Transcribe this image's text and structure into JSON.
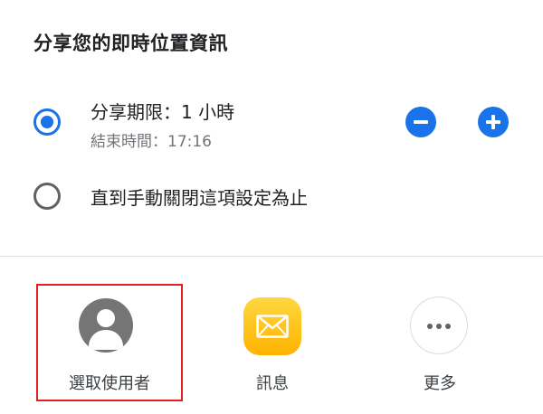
{
  "dialog": {
    "title": "分享您的即時位置資訊"
  },
  "options": [
    {
      "label": "分享期限：1 小時",
      "sublabel": "結束時間：17:16",
      "selected": true
    },
    {
      "label": "直到手動關閉這項設定為止",
      "selected": false
    }
  ],
  "duration_controls": {
    "decrease_icon": "minus-icon",
    "increase_icon": "plus-icon",
    "accent_color": "#1a73e8"
  },
  "share_targets": [
    {
      "label": "選取使用者",
      "icon": "person-icon",
      "highlighted": true,
      "highlight_color": "#e02020"
    },
    {
      "label": "訊息",
      "icon": "envelope-icon",
      "icon_color": "#ffc107"
    },
    {
      "label": "更多",
      "icon": "more-horizontal-icon"
    }
  ]
}
